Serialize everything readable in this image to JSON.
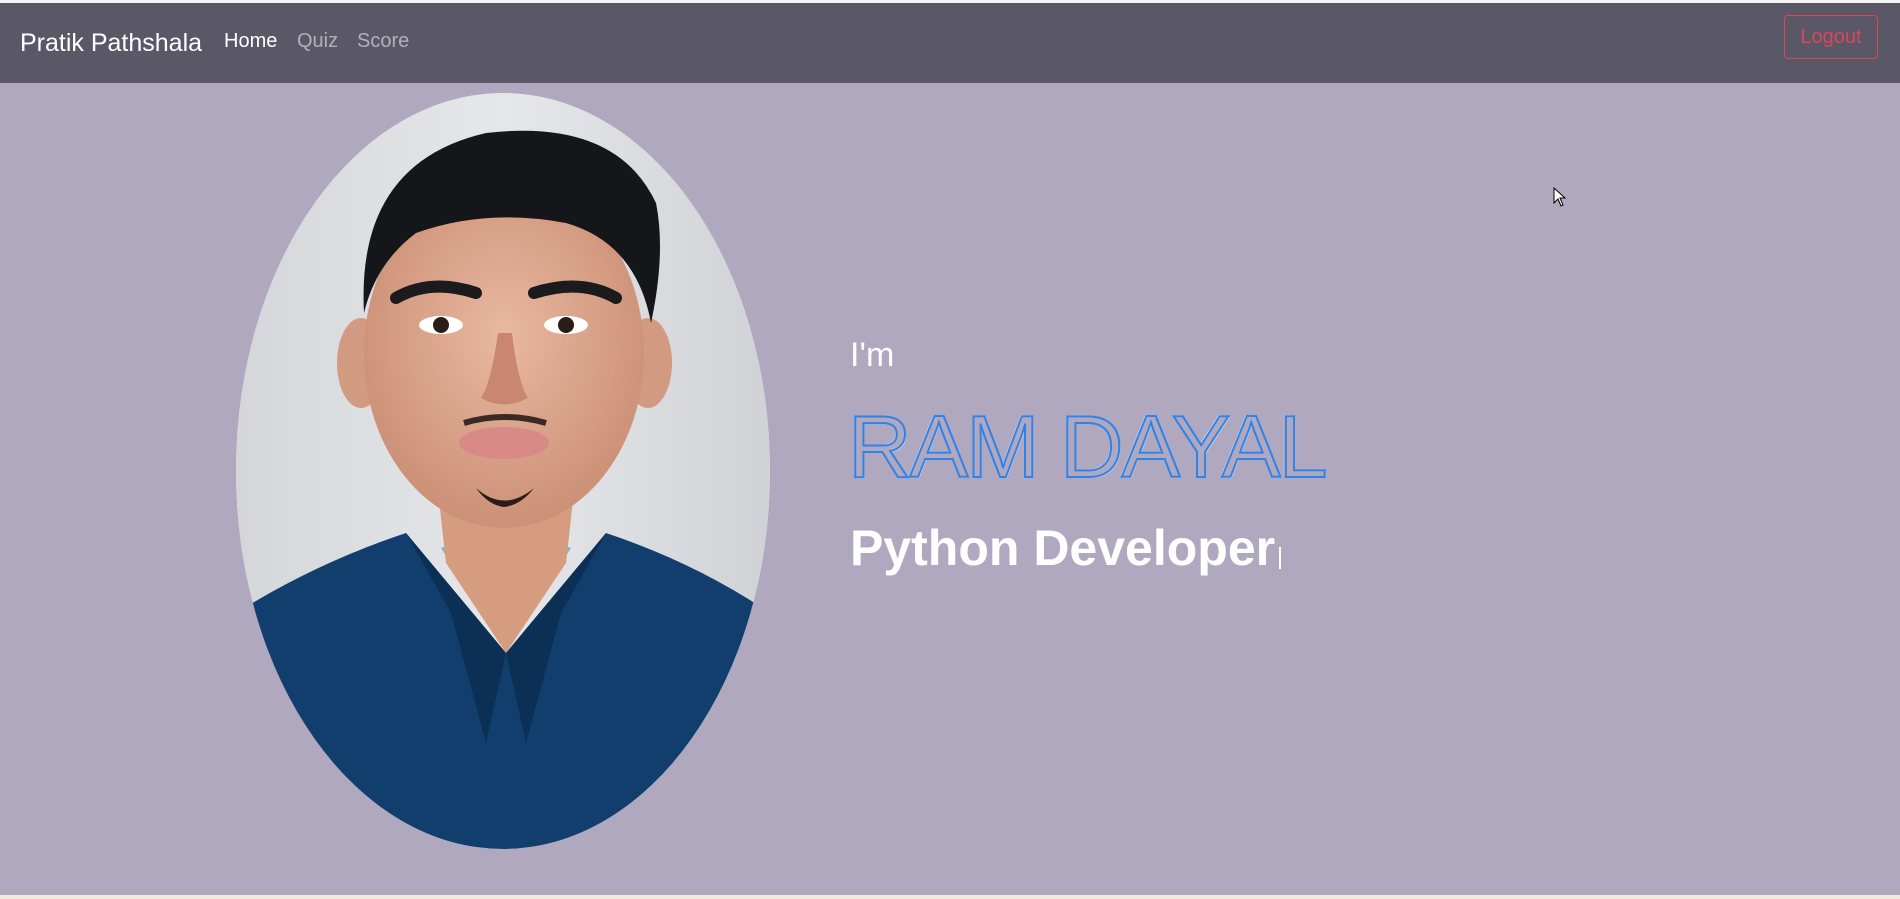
{
  "navbar": {
    "brand": "Pratik Pathshala",
    "links": [
      {
        "label": "Home",
        "active": true
      },
      {
        "label": "Quiz",
        "active": false
      },
      {
        "label": "Score",
        "active": false
      }
    ],
    "logout_label": "Logout"
  },
  "hero": {
    "intro": "I'm",
    "name": "RAM DAYAL",
    "role": "Python Developer"
  },
  "colors": {
    "navbar_bg": "#5a5766",
    "hero_bg": "#b0a8bf",
    "logout_accent": "#d9475a",
    "name_outline": "#2f82e8"
  },
  "icons": {
    "cursor": "mouse-pointer-icon"
  }
}
